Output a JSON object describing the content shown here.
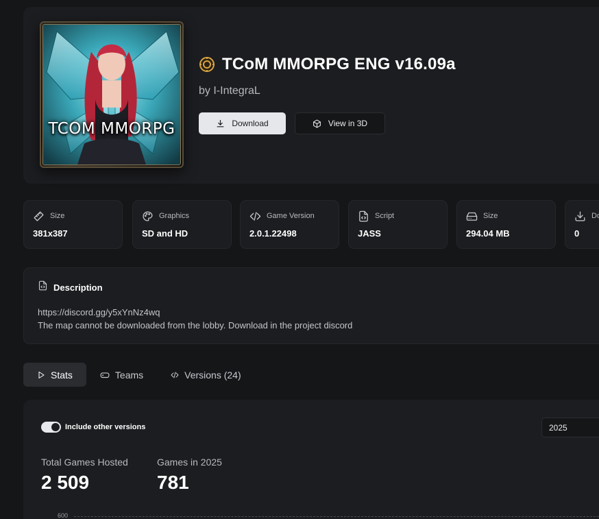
{
  "map": {
    "cover_text": "TCOM MMORPG",
    "title": "TCoM MMORPG ENG v16.09a",
    "author": "by I-IntegraL"
  },
  "actions": {
    "download_label": "Download",
    "view3d_label": "View in 3D"
  },
  "stats": [
    {
      "label": "Size",
      "value": "381x387",
      "icon": "ruler-icon"
    },
    {
      "label": "Graphics",
      "value": "SD and HD",
      "icon": "palette-icon"
    },
    {
      "label": "Game Version",
      "value": "2.0.1.22498",
      "icon": "code-icon"
    },
    {
      "label": "Script",
      "value": "JASS",
      "icon": "file-code-icon"
    },
    {
      "label": "Size",
      "value": "294.04 MB",
      "icon": "hard-drive-icon"
    },
    {
      "label": "Do",
      "value": "0",
      "icon": "download-icon"
    }
  ],
  "description": {
    "title": "Description",
    "lines": [
      "https://discord.gg/y5xYnNz4wq",
      "The map cannot be downloaded from the lobby. Download in the project discord"
    ]
  },
  "tabs": [
    {
      "label": "Stats",
      "icon": "play-icon",
      "active": true
    },
    {
      "label": "Teams",
      "icon": "gamepad-icon",
      "active": false
    },
    {
      "label": "Versions (24)",
      "icon": "code-icon",
      "active": false
    }
  ],
  "panel": {
    "toggle_label": "Include other versions",
    "toggle_on": true,
    "year_selected": "2025",
    "metrics": [
      {
        "label": "Total Games Hosted",
        "value": "2 509"
      },
      {
        "label": "Games in 2025",
        "value": "781"
      }
    ],
    "chart_tick_top": "600"
  },
  "colors": {
    "background": "#151618",
    "card": "#1c1d20",
    "accent_button": "#e6e7ea",
    "title_icon": "#d9a441"
  }
}
